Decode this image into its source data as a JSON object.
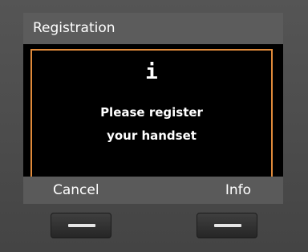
{
  "screen": {
    "title": "Registration",
    "icon": "info-icon",
    "icon_glyph": "i",
    "message_line1": "Please register",
    "message_line2": "your handset",
    "accent_color": "#e08a3a"
  },
  "softkeys": {
    "left_label": "Cancel",
    "right_label": "Info"
  }
}
